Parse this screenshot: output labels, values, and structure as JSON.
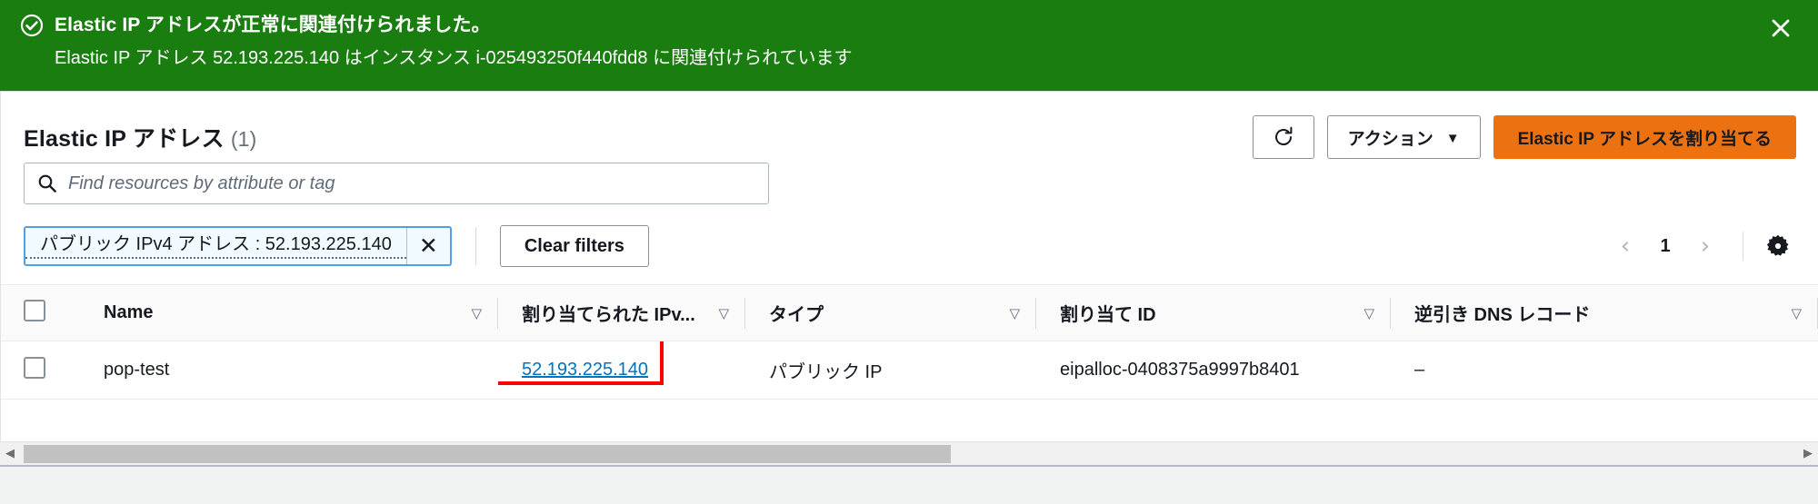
{
  "banner": {
    "icon": "circle-check-icon",
    "title": "Elastic IP アドレスが正常に関連付けられました。",
    "detail": "Elastic IP アドレス 52.193.225.140 はインスタンス i-025493250f440fdd8 に関連付けられています",
    "close_label": "✕",
    "background_color": "#1a7d10"
  },
  "panel": {
    "title": "Elastic IP アドレス",
    "count": "(1)"
  },
  "toolbar": {
    "refresh_icon": "refresh-icon",
    "actions_label": "アクション",
    "actions_caret": "▼",
    "allocate_label": "Elastic IP アドレスを割り当てる",
    "primary_color": "#ec7211"
  },
  "search": {
    "icon": "search-icon",
    "placeholder": "Find resources by attribute or tag",
    "value": ""
  },
  "filters": {
    "token_label": "パブリック IPv4 アドレス : 52.193.225.140",
    "token_remove": "✕",
    "clear_label": "Clear filters"
  },
  "pagination": {
    "prev": "‹",
    "page": "1",
    "next": "›",
    "settings_icon": "gear-icon"
  },
  "table": {
    "sort_icon": "▽",
    "columns": [
      {
        "label": "Name"
      },
      {
        "label": "割り当てられた IPv..."
      },
      {
        "label": "タイプ"
      },
      {
        "label": "割り当て ID"
      },
      {
        "label": "逆引き DNS レコード"
      }
    ],
    "rows": [
      {
        "name": "pop-test",
        "ipv4": "52.193.225.140",
        "type": "パブリック IP",
        "allocation_id": "eipalloc-0408375a9997b8401",
        "reverse_dns": "–"
      }
    ],
    "highlight_color": "#ff0000"
  },
  "scrollbar": {
    "left_arrow": "◀",
    "right_arrow": "▶"
  }
}
